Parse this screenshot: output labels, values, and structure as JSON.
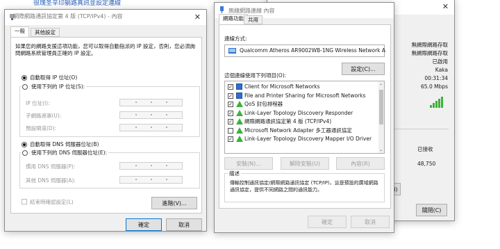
{
  "top_note": "很瑰圣辛印躺路真訊並設定連線",
  "ipv4": {
    "title": "網際網路通訊協定第 4 版 (TCP/IPv4) - 內容",
    "tabs": [
      "一般",
      "其他設定"
    ],
    "intro": "如果您的網路支援這項功能，您可以取得自動指派的 IP 設定，否則，您必須詢問網路系統管理員正確的 IP 設定。",
    "auto_ip": "自動取得 IP 位址(O)",
    "manual_ip": "使用下列的 IP 位址(S):",
    "ip_label": "IP 位址(I):",
    "mask_label": "子網路遮罩(U):",
    "gateway_label": "預設閘道(D):",
    "auto_dns": "自動取得 DNS 伺服器位址(B)",
    "manual_dns": "使用下列的 DNS 伺服器位址(E):",
    "pref_dns": "慣用 DNS 伺服器(P):",
    "alt_dns": "其他 DNS 伺服器(A):",
    "validate": "結束時確認設定(L)",
    "advanced": "進階(V)...",
    "ok": "確定",
    "cancel": "取消"
  },
  "wifi": {
    "title": "無線網路連線 內容",
    "tabs": [
      "網路功能",
      "共用"
    ],
    "connect_using": "連線方式:",
    "adapter": "Qualcomm Atheros AR9002WB-1NG Wireless Network A",
    "configure": "設定(C)...",
    "uses_label": "這個連線使用下列項目(O):",
    "items": [
      {
        "label": "Client for Microsoft Networks",
        "checked": true
      },
      {
        "label": "File and Printer Sharing for Microsoft Networks",
        "checked": true
      },
      {
        "label": "QoS 封包排程器",
        "checked": true
      },
      {
        "label": "Link-Layer Topology Discovery Responder",
        "checked": true
      },
      {
        "label": "網際網路通訊協定第 4 版 (TCP/IPv4)",
        "checked": true
      },
      {
        "label": "Microsoft Network Adapter 多工器通訊協定",
        "checked": false
      },
      {
        "label": "Link-Layer Topology Discovery Mapper I/O Driver",
        "checked": true
      }
    ],
    "install": "安裝(N)...",
    "uninstall": "解除安裝(U)",
    "properties": "內容(R)",
    "desc_title": "描述",
    "desc_text": "傳輸控制通訊協定/網際網路通訊協定 (TCP/IP)，這是預設的廣域網路通訊協定，提供不同網路之間的通訊能力。",
    "ok": "確定",
    "cancel": "取消"
  },
  "status": {
    "rows": [
      "無網際網路存取",
      "無網際網路存取",
      "已啟用",
      "Kaka",
      "00:31:34",
      "65.0 Mbps"
    ],
    "received_label": "已接收",
    "received": "48,750",
    "close": "關閉(C)",
    "partial_btn": "i)"
  }
}
